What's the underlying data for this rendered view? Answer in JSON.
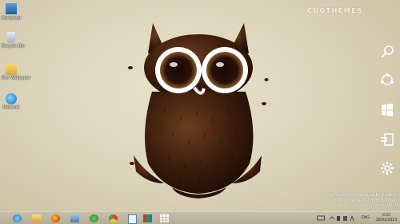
{
  "desktop": {
    "icons": [
      {
        "label": "Computer",
        "icon": "computer-icon"
      },
      {
        "label": "Recycle Bin",
        "icon": "recycle-bin-icon"
      },
      {
        "label": "Owl Wallpaper",
        "icon": "folder-icon"
      },
      {
        "label": "Network",
        "icon": "network-icon"
      }
    ],
    "watermark": "CUOTHEMES"
  },
  "charms": [
    "search-charm-icon",
    "share-charm-icon",
    "start-charm-icon",
    "devices-charm-icon",
    "settings-charm-icon"
  ],
  "evaluation": {
    "line1": "Windows 8 Enterprise Evaluation",
    "line2": "Windows License valid for 81 days",
    "line3": "Build 9200"
  },
  "taskbar": {
    "pinned": [
      "internet-explorer-icon",
      "file-explorer-icon",
      "firefox-icon",
      "network-app-icon",
      "media-icon",
      "chrome-icon",
      "document-icon",
      "flag-app-icon",
      "grid-app-icon"
    ],
    "language": "ENG",
    "time": "9:25",
    "date": "28/04/2013"
  },
  "colors": {
    "background": "#e2dac3",
    "taskbar": "#bdb49a",
    "text_white": "#ffffff"
  }
}
